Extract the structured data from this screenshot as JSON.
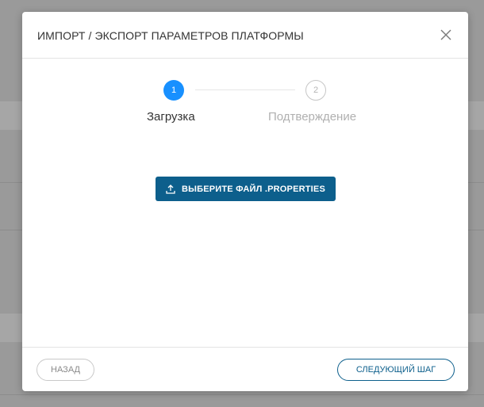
{
  "dialog": {
    "title": "ИМПОРТ / ЭКСПОРТ ПАРАМЕТРОВ ПЛАТФОРМЫ",
    "close_icon": "close-icon"
  },
  "stepper": {
    "steps": [
      {
        "number": "1",
        "label": "Загрузка",
        "state": "active"
      },
      {
        "number": "2",
        "label": "Подтверждение",
        "state": "pending"
      }
    ],
    "active_color": "#1890ff"
  },
  "upload": {
    "label": "ВЫБЕРИТЕ ФАЙЛ .PROPERTIES",
    "icon": "upload-icon",
    "color": "#0d5f8c"
  },
  "footer": {
    "back_label": "НАЗАД",
    "next_label": "СЛЕДУЮЩИЙ ШАГ"
  }
}
